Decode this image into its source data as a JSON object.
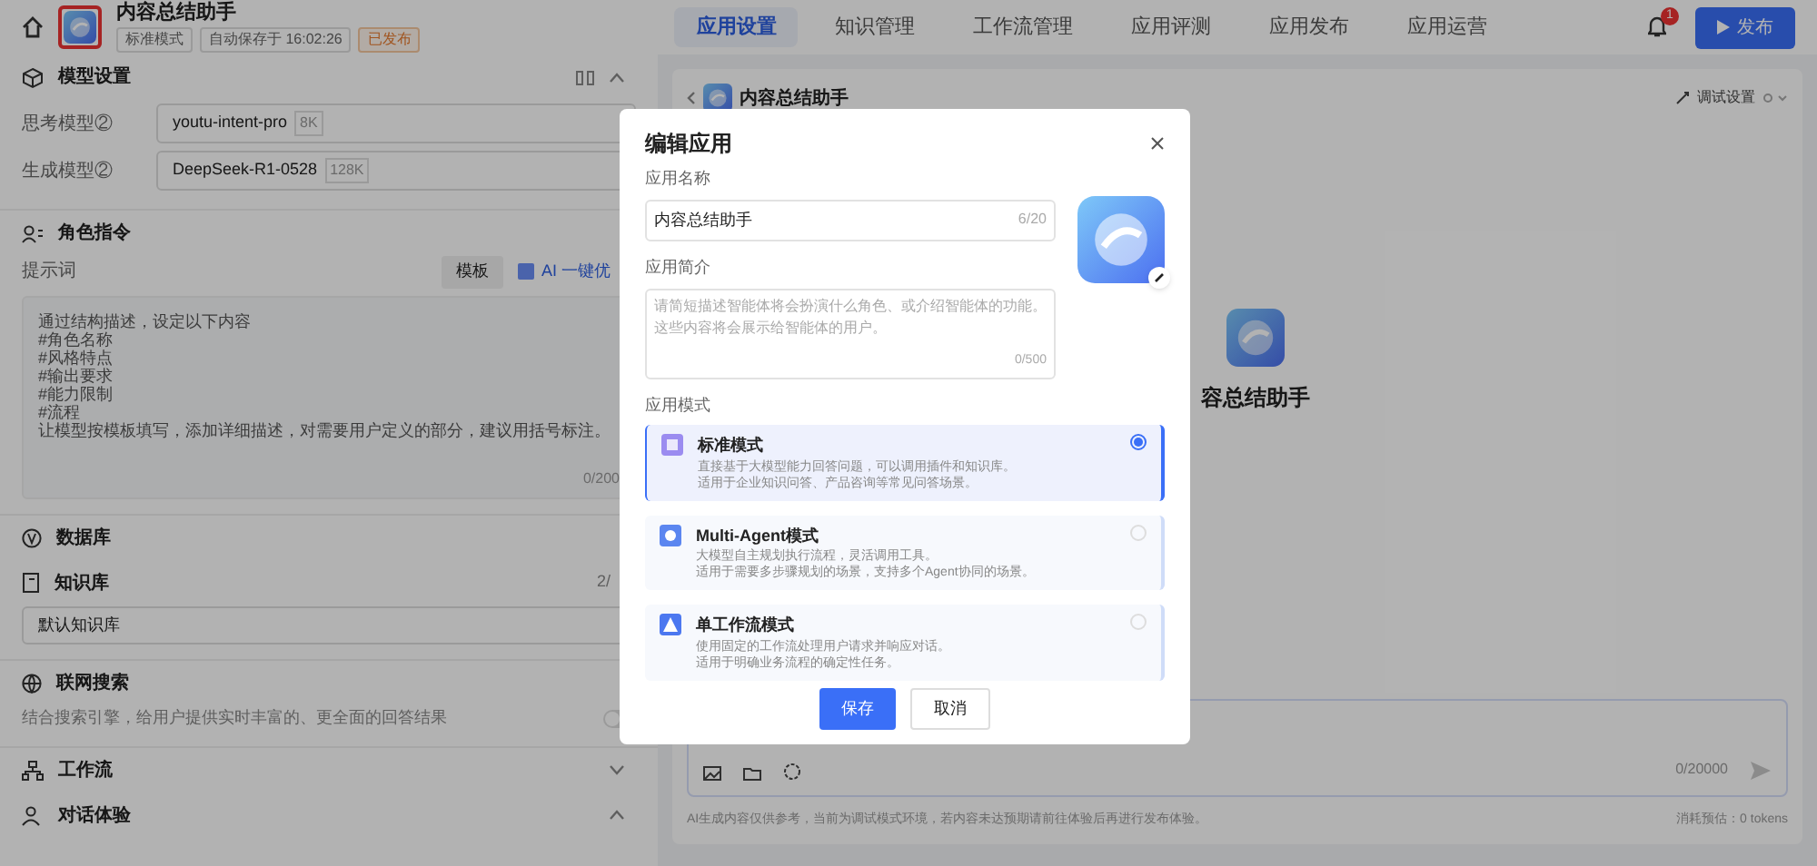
{
  "header": {
    "title": "内容总结助手",
    "tags": [
      {
        "text": "标准模式",
        "kind": "plain"
      },
      {
        "text": "自动保存于 16:02:26",
        "kind": "plain"
      },
      {
        "text": "已发布",
        "kind": "warn"
      }
    ],
    "tabs": [
      {
        "label": "应用设置",
        "selected": true
      },
      {
        "label": "知识管理",
        "selected": false
      },
      {
        "label": "工作流管理",
        "selected": false
      },
      {
        "label": "应用评测",
        "selected": false
      },
      {
        "label": "应用发布",
        "selected": false
      },
      {
        "label": "应用运营",
        "selected": false
      }
    ],
    "notification_count": "1",
    "publish_button": "发布"
  },
  "settings": {
    "model": {
      "title": "模型设置",
      "fields": [
        {
          "label": "思考模型②",
          "value": "youtu-intent-pro",
          "badge": "8K"
        },
        {
          "label": "生成模型②",
          "value": "DeepSeek-R1-0528",
          "badge": "128K"
        }
      ]
    },
    "role": {
      "title": "角色指令",
      "prompt_label": "提示词",
      "template_button": "模板",
      "optimize_button": "AI 一键优",
      "lines": [
        "通过结构描述，设定以下内容",
        "#角色名称",
        "#风格特点",
        "#输出要求",
        "#能力限制",
        "#流程",
        "让模型按模板填写，添加详细描述，对需要用户定义的部分，建议用括号标注。"
      ],
      "counter": "0/200"
    },
    "database": {
      "title": "数据库"
    },
    "knowledge": {
      "title": "知识库",
      "count": "2/",
      "item": "默认知识库"
    },
    "web_search": {
      "title": "联网搜索",
      "description": "结合搜索引擎，给用户提供实时丰富的、更全面的回答结果",
      "on": false
    },
    "sections": [
      {
        "title": "工作流",
        "expanded": false
      },
      {
        "title": "对话体验",
        "expanded": true
      }
    ]
  },
  "preview": {
    "title": "内容总结助手",
    "debug_button": "调试设置",
    "app_name": "容总结助手",
    "input_counter": "0/20000",
    "footer_note": "AI生成内容仅供参考，当前为调试模式环境，若内容未达预期请前往体验后再进行发布体验。",
    "footer_right": "消耗预估：0 tokens"
  },
  "dialog": {
    "title": "编辑应用",
    "name_label": "应用名称",
    "name_value": "内容总结助手",
    "name_counter": "6/20",
    "intro_label": "应用简介",
    "intro_placeholder": "请简短描述智能体将会扮演什么角色、或介绍智能体的功能。这些内容将会展示给智能体的用户。",
    "intro_counter": "0/500",
    "mode_label": "应用模式",
    "modes": [
      {
        "title": "标准模式",
        "lines": [
          "直接基于大模型能力回答问题，可以调用插件和知识库。",
          "适用于企业知识问答、产品咨询等常见问答场景。"
        ],
        "selected": true,
        "kind": "standard"
      },
      {
        "title": "Multi-Agent模式",
        "lines": [
          "大模型自主规划执行流程，灵活调用工具。",
          "适用于需要多步骤规划的场景，支持多个Agent协同的场景。"
        ],
        "selected": false,
        "kind": "agent"
      },
      {
        "title": "单工作流模式",
        "lines": [
          "使用固定的工作流处理用户请求并响应对话。",
          "适用于明确业务流程的确定性任务。"
        ],
        "selected": false,
        "kind": "workflow"
      }
    ],
    "buttons": [
      {
        "label": "保存",
        "kind": "primary"
      },
      {
        "label": "取消",
        "kind": "secondary"
      }
    ]
  }
}
